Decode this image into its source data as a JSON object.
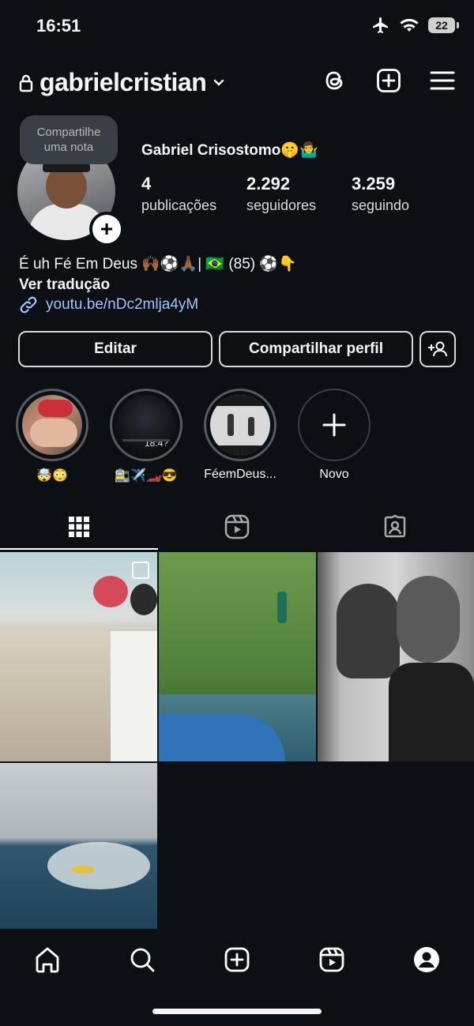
{
  "status": {
    "time": "16:51",
    "battery": "22"
  },
  "header": {
    "username": "gabrielcristian"
  },
  "profile": {
    "note": [
      "Compartilhe",
      "uma nota"
    ],
    "full_name": "Gabriel Crisostomo🤫🤷‍♂️",
    "stats": [
      {
        "value": "4",
        "label": "publicações"
      },
      {
        "value": "2.292",
        "label": "seguidores"
      },
      {
        "value": "3.259",
        "label": "seguindo"
      }
    ],
    "bio": "É uh Fé Em Deus 🙌🏾⚽🙏🏾| 🇧🇷 (85) ⚽👇",
    "translate": "Ver tradução",
    "link": "youtu.be/nDc2mlja4yM"
  },
  "buttons": {
    "edit": "Editar",
    "share": "Compartilhar perfil"
  },
  "highlights": [
    {
      "label": "🤯😳"
    },
    {
      "label": "🚉✈️🏎️😎",
      "overlay_text": "18:4?"
    },
    {
      "label": "FéemDeus..."
    },
    {
      "label": "Novo"
    }
  ],
  "icons": {
    "lock": "lock-icon",
    "threads": "threads-icon",
    "create": "plus-square-icon",
    "menu": "hamburger-menu-icon",
    "link": "link-icon",
    "add_friend": "add-person-icon",
    "grid": "grid-icon",
    "reels": "reels-icon",
    "tagged": "tagged-icon",
    "home": "home-icon",
    "search": "search-icon",
    "profile": "profile-icon"
  }
}
